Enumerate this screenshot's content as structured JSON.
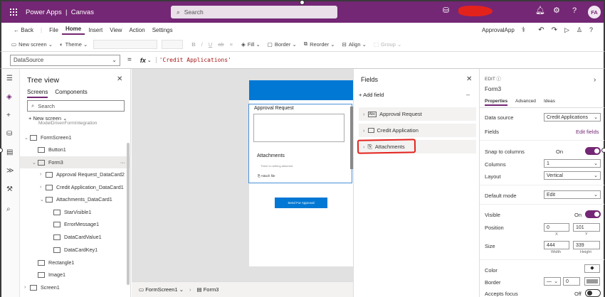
{
  "app": {
    "brand": "Power Apps",
    "divider": "|",
    "mode": "Canvas"
  },
  "search": {
    "placeholder": "Search",
    "icon": "search-icon"
  },
  "user": {
    "initials": "FA"
  },
  "menu": {
    "back": "Back",
    "items": [
      "File",
      "Home",
      "Insert",
      "View",
      "Action",
      "Settings"
    ],
    "active": "Home",
    "app_name": "ApprovalApp"
  },
  "toolbar": {
    "new_screen": "New screen",
    "theme": "Theme",
    "fill": "Fill",
    "border": "Border",
    "reorder": "Reorder",
    "align": "Align",
    "group": "Group"
  },
  "formula": {
    "property": "DataSource",
    "eq": "=",
    "fx": "fx",
    "value": "'Credit Applications'"
  },
  "tree": {
    "title": "Tree view",
    "tabs": [
      "Screens",
      "Components"
    ],
    "search_placeholder": "Search",
    "new_screen": "New screen",
    "cut_item": "ModelDrivenFormIntegration",
    "items": [
      {
        "label": "FormScreen1",
        "indent": 0,
        "chev": "⌄"
      },
      {
        "label": "Button1",
        "indent": 1,
        "chev": ""
      },
      {
        "label": "Form3",
        "indent": 1,
        "chev": "⌄",
        "selected": true
      },
      {
        "label": "Approval Request_DataCard2",
        "indent": 2,
        "chev": "›"
      },
      {
        "label": "Credit Application_DataCard1",
        "indent": 2,
        "chev": "›"
      },
      {
        "label": "Attachments_DataCard1",
        "indent": 2,
        "chev": "⌄"
      },
      {
        "label": "StarVisible1",
        "indent": 3,
        "chev": ""
      },
      {
        "label": "ErrorMessage1",
        "indent": 3,
        "chev": ""
      },
      {
        "label": "DataCardValue1",
        "indent": 3,
        "chev": ""
      },
      {
        "label": "DataCardKey1",
        "indent": 3,
        "chev": ""
      },
      {
        "label": "Rectangle1",
        "indent": 1,
        "chev": ""
      },
      {
        "label": "Image1",
        "indent": 1,
        "chev": ""
      },
      {
        "label": "Screen1",
        "indent": 0,
        "chev": "›"
      }
    ],
    "more": "···"
  },
  "canvas": {
    "approval_label": "Approval Request",
    "attachments_label": "Attachments",
    "nothing_attached": "There is nothing attached.",
    "attach_file": "Attach file",
    "send_button": "Send For Approval"
  },
  "status": {
    "screen": "FormScreen1",
    "control": "Form3"
  },
  "fields_panel": {
    "title": "Fields",
    "add_field": "Add field",
    "items": [
      {
        "label": "Approval Request",
        "icon": "text-field-icon"
      },
      {
        "label": "Credit Application",
        "icon": "lookup-field-icon"
      },
      {
        "label": "Attachments",
        "icon": "paperclip-icon"
      }
    ],
    "highlight_color": "#e3221c"
  },
  "properties": {
    "edit": "EDIT",
    "control": "Form3",
    "tabs": [
      "Properties",
      "Advanced",
      "Ideas"
    ],
    "data_source_label": "Data source",
    "data_source_value": "Credit Applications",
    "fields_label": "Fields",
    "edit_fields": "Edit fields",
    "snap_label": "Snap to columns",
    "snap_value": "On",
    "columns_label": "Columns",
    "columns_value": "1",
    "layout_label": "Layout",
    "layout_value": "Vertical",
    "default_mode_label": "Default mode",
    "default_mode_value": "Edit",
    "visible_label": "Visible",
    "visible_value": "On",
    "position_label": "Position",
    "x_value": "0",
    "y_value": "101",
    "x_label": "X",
    "y_label": "Y",
    "size_label": "Size",
    "width_value": "444",
    "height_value": "339",
    "width_label": "Width",
    "height_label": "Height",
    "color_label": "Color",
    "border_label": "Border",
    "border_width": "0",
    "accepts_focus_label": "Accepts focus",
    "accepts_focus_value": "Off"
  },
  "colors": {
    "brand": "#742774",
    "accent": "#0078d4",
    "annotation": "#e3221c"
  }
}
